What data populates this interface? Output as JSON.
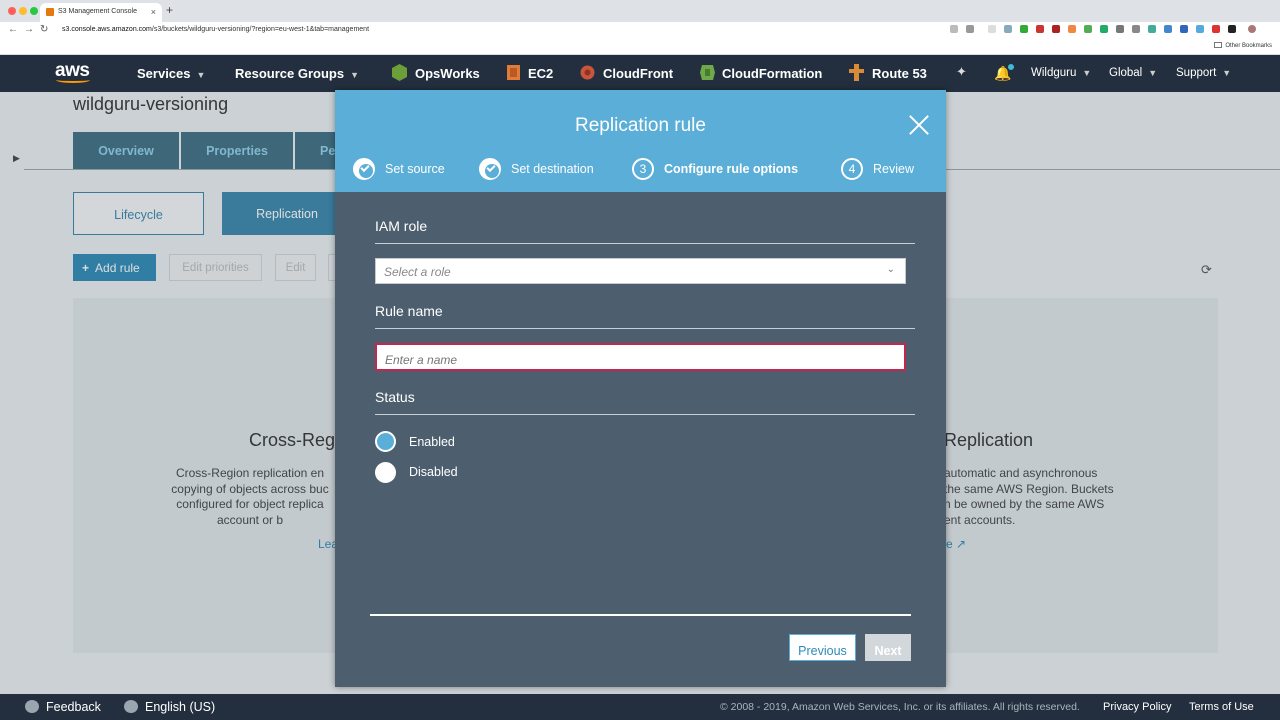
{
  "browser": {
    "tab_title": "S3 Management Console",
    "url_host": "s3.console.aws.amazon.com",
    "url_path": "/s3/buckets/wildguru-versioning/?region=eu-west-1&tab=management",
    "bookmarks_label": "Other Bookmarks"
  },
  "awsnav": {
    "logo": "aws",
    "services": "Services",
    "resource_groups": "Resource Groups",
    "shortcuts": [
      {
        "label": "OpsWorks",
        "color": "#6a9f3a"
      },
      {
        "label": "EC2",
        "color": "#e07b39"
      },
      {
        "label": "CloudFront",
        "color": "#c8553d"
      },
      {
        "label": "CloudFormation",
        "color": "#6fa84a"
      },
      {
        "label": "Route 53",
        "color": "#d98b3a"
      }
    ],
    "account": "Wildguru",
    "region": "Global",
    "support": "Support"
  },
  "page": {
    "bucket_name": "wildguru-versioning",
    "tabs": [
      "Overview",
      "Properties",
      "Pe"
    ],
    "subtabs": [
      "Lifecycle",
      "Replication"
    ],
    "actions": {
      "add_rule": "Add rule",
      "edit_priorities": "Edit priorities",
      "edit": "Edit"
    },
    "left_heading": "Cross-Reg",
    "left_text": [
      "Cross-Region replication en",
      "copying of objects across buc",
      "configured for object replica",
      "account or b"
    ],
    "left_link": "Lea",
    "right_heading": "Replication",
    "right_text": [
      "automatic and asynchronous",
      "the same AWS Region. Buckets",
      "n be owned by the same AWS",
      "ent accounts."
    ],
    "right_link": "e"
  },
  "modal": {
    "title": "Replication rule",
    "steps": [
      {
        "label": "Set source",
        "state": "done",
        "num": ""
      },
      {
        "label": "Set destination",
        "state": "done",
        "num": ""
      },
      {
        "label": "Configure rule options",
        "state": "active",
        "num": "3"
      },
      {
        "label": "Review",
        "state": "pending",
        "num": "4"
      }
    ],
    "iam_role_label": "IAM role",
    "iam_role_placeholder": "Select a role",
    "rule_name_label": "Rule name",
    "rule_name_placeholder": "Enter a name",
    "status_label": "Status",
    "status_options": [
      {
        "label": "Enabled",
        "selected": true
      },
      {
        "label": "Disabled",
        "selected": false
      }
    ],
    "previous_label": "Previous",
    "next_label": "Next"
  },
  "footer": {
    "feedback": "Feedback",
    "language": "English (US)",
    "copyright": "© 2008 - 2019, Amazon Web Services, Inc. or its affiliates. All rights reserved.",
    "privacy": "Privacy Policy",
    "terms": "Terms of Use"
  }
}
